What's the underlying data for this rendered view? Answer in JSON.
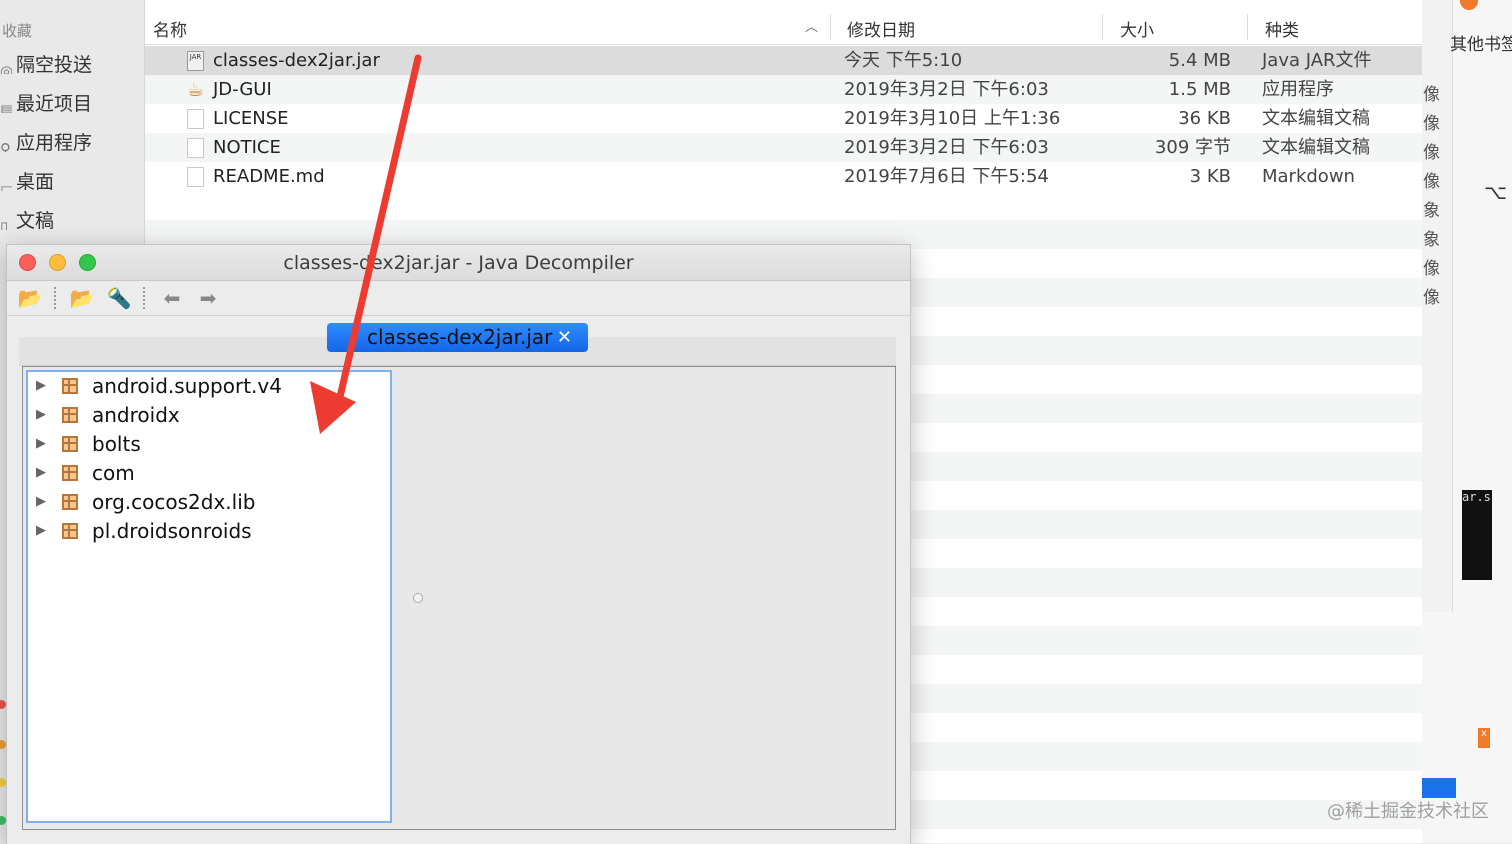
{
  "sidebar": {
    "heading": "收藏",
    "items": [
      {
        "icon": "airdrop-icon",
        "label": "隔空投送"
      },
      {
        "icon": "recents-icon",
        "label": "最近项目"
      },
      {
        "icon": "applications-icon",
        "label": "应用程序"
      },
      {
        "icon": "desktop-icon",
        "label": "桌面"
      },
      {
        "icon": "documents-icon",
        "label": "文稿"
      }
    ]
  },
  "finder": {
    "columns": {
      "name": "名称",
      "date": "修改日期",
      "size": "大小",
      "kind": "种类"
    },
    "files": [
      {
        "name": "classes-dex2jar.jar",
        "date": "今天 下午5:10",
        "size": "5.4 MB",
        "kind": "Java JAR文件",
        "icon": "jar-icon",
        "selected": true
      },
      {
        "name": "JD-GUI",
        "date": "2019年3月2日 下午6:03",
        "size": "1.5 MB",
        "kind": "应用程序",
        "icon": "coffee-cup-icon"
      },
      {
        "name": "LICENSE",
        "date": "2019年3月10日 上午1:36",
        "size": "36 KB",
        "kind": "文本编辑文稿",
        "icon": "document-icon"
      },
      {
        "name": "NOTICE",
        "date": "2019年3月2日 下午6:03",
        "size": "309 字节",
        "kind": "文本编辑文稿",
        "icon": "document-icon"
      },
      {
        "name": "README.md",
        "date": "2019年7月6日 下午5:54",
        "size": "3 KB",
        "kind": "Markdown",
        "icon": "document-icon"
      }
    ]
  },
  "jd_gui": {
    "window_title": "classes-dex2jar.jar - Java Decompiler",
    "toolbar": [
      "open-file-icon",
      "open-type-icon",
      "search-icon",
      "back-icon",
      "forward-icon"
    ],
    "tab_label": "classes-dex2jar.jar",
    "tree": [
      "android.support.v4",
      "androidx",
      "bolts",
      "com",
      "org.cocos2dx.lib",
      "pl.droidsonroids"
    ]
  },
  "right_strip": {
    "bookmark_text": "其他书签",
    "side_chars": [
      "像",
      "像",
      "像",
      "像",
      "象",
      "象",
      "像",
      "像"
    ],
    "terminal_text": "ar.s",
    "watermark": "@稀土掘金技术社区"
  },
  "colors": {
    "annotation_arrow": "#ee3b32",
    "selection_row": "#dcdcdc",
    "tab_blue": "#1a6ff0",
    "tree_border": "#7fb1ee"
  }
}
